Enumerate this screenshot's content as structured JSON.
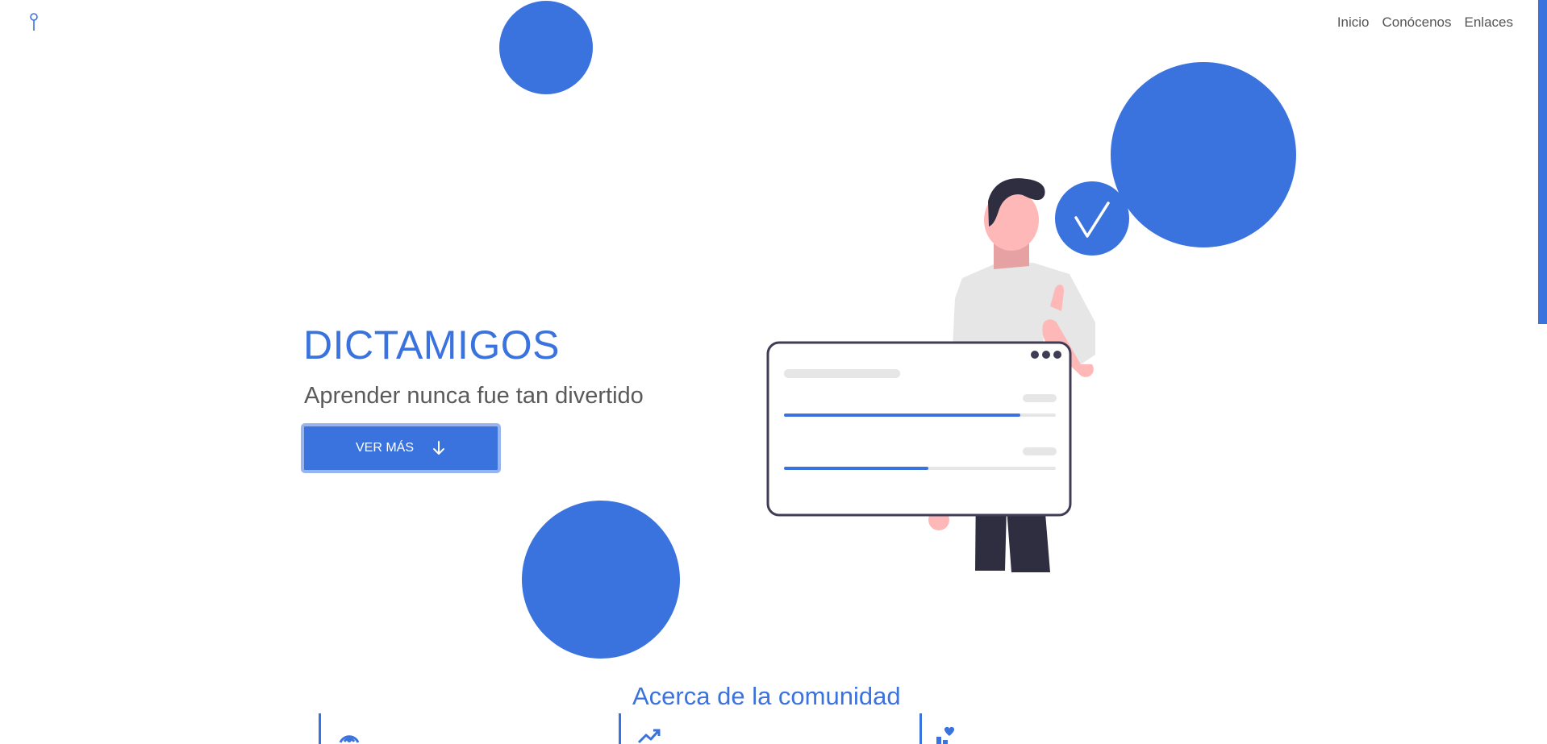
{
  "nav": {
    "items": [
      {
        "label": "Inicio"
      },
      {
        "label": "Conócenos"
      },
      {
        "label": "Enlaces"
      }
    ]
  },
  "hero": {
    "title": "DICTAMIGOS",
    "subtitle": "Aprender nunca fue tan divertido",
    "cta_label": "VER MÁS",
    "cta_icon": "arrow-down-icon"
  },
  "illustration": {
    "progress_bars": [
      {
        "fill": 0.87
      },
      {
        "fill": 0.53
      }
    ]
  },
  "about": {
    "title": "Acerca de la comunidad",
    "feature_icons": [
      "broadcast-icon",
      "trending-up-icon",
      "community-heart-icon"
    ]
  },
  "colors": {
    "accent": "#3b73de",
    "text": "#5a5a5a",
    "dark": "#2f2e41",
    "skin": "#ffb8b8"
  }
}
